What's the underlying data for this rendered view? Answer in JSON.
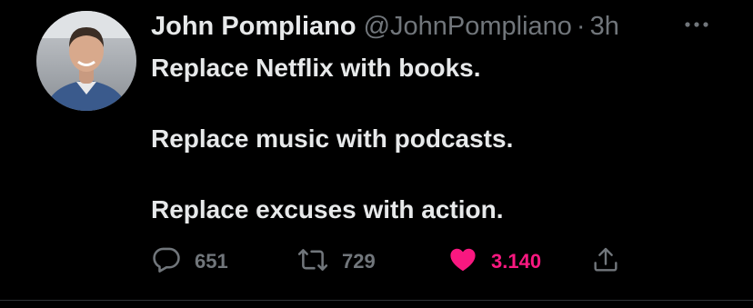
{
  "tweet": {
    "author_name": "John Pompliano",
    "handle": "@JohnPompliano",
    "separator": "·",
    "time": "3h",
    "lines": [
      "Replace Netflix with books.",
      "",
      "Replace music with podcasts.",
      "",
      "Replace excuses with action."
    ]
  },
  "actions": {
    "reply": {
      "icon": "reply-icon",
      "count": "651"
    },
    "retweet": {
      "icon": "retweet-icon",
      "count": "729"
    },
    "like": {
      "icon": "heart-icon",
      "count": "3.140",
      "liked": true
    },
    "share": {
      "icon": "share-icon"
    }
  },
  "colors": {
    "background": "#000000",
    "text": "#e7e9ea",
    "secondary": "#71767b",
    "like": "#f91880"
  }
}
